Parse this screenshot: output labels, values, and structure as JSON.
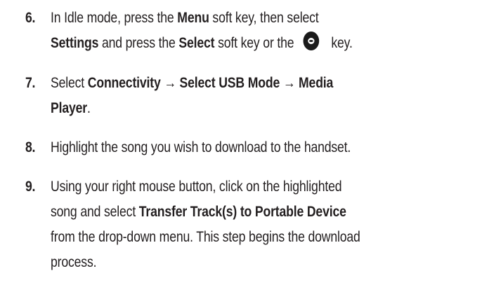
{
  "steps": [
    {
      "number": "6.",
      "line1_a": "In Idle mode, press the ",
      "line1_b": "Menu",
      "line1_c": " soft key, then select",
      "line2_a": "Settings",
      "line2_b": " and press the ",
      "line2_c": "Select",
      "line2_d": " soft key or the",
      "line2_e": "key.",
      "icon": "select-key-icon"
    },
    {
      "number": "7.",
      "line1_a": "Select ",
      "line1_b": "Connectivity → Select USB Mode → Media",
      "line2_a": "Player",
      "line2_b": "."
    },
    {
      "number": "8.",
      "line1_a": "Highlight the song you wish to download to the handset."
    },
    {
      "number": "9.",
      "line1_a": "Using your right mouse button, click on the highlighted",
      "line2_a": "song and select ",
      "line2_b": "Transfer Track(s) to Portable Device",
      "line3_a": "from the drop-down menu. This step begins the download",
      "line4_a": "process."
    }
  ]
}
